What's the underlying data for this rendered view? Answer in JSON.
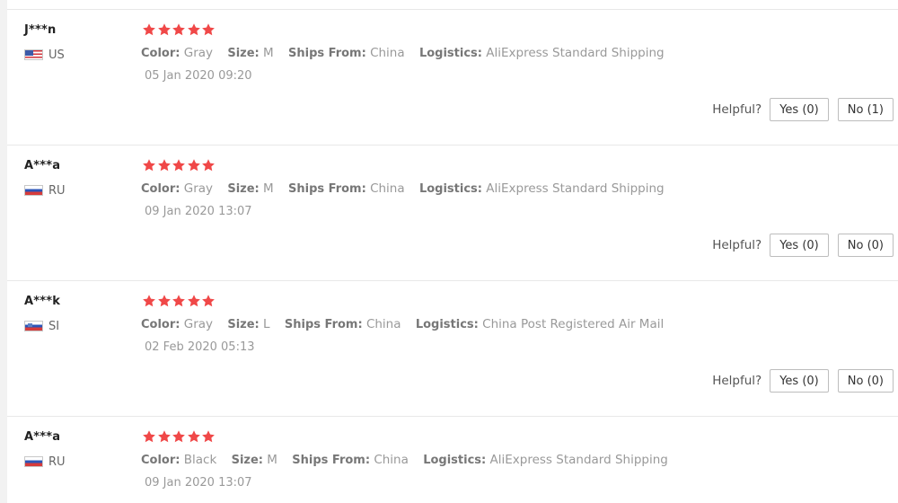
{
  "labels": {
    "color": "Color:",
    "size": "Size:",
    "ships_from": "Ships From:",
    "logistics": "Logistics:",
    "helpful": "Helpful?"
  },
  "star_color": "#f04848",
  "reviews": [
    {
      "user": "J***n",
      "country": "US",
      "flag_icon": "us-flag-icon",
      "rating": 5,
      "color": "Gray",
      "size": "M",
      "ships_from": "China",
      "logistics": "AliExpress Standard Shipping",
      "date": "05 Jan 2020 09:20",
      "yes": "Yes (0)",
      "no": "No (1)"
    },
    {
      "user": "A***a",
      "country": "RU",
      "flag_icon": "ru-flag-icon",
      "rating": 5,
      "color": "Gray",
      "size": "M",
      "ships_from": "China",
      "logistics": "AliExpress Standard Shipping",
      "date": "09 Jan 2020 13:07",
      "yes": "Yes (0)",
      "no": "No (0)"
    },
    {
      "user": "A***k",
      "country": "SI",
      "flag_icon": "si-flag-icon",
      "rating": 5,
      "color": "Gray",
      "size": "L",
      "ships_from": "China",
      "logistics": "China Post Registered Air Mail",
      "date": "02 Feb 2020 05:13",
      "yes": "Yes (0)",
      "no": "No (0)"
    },
    {
      "user": "A***a",
      "country": "RU",
      "flag_icon": "ru-flag-icon",
      "rating": 5,
      "color": "Black",
      "size": "M",
      "ships_from": "China",
      "logistics": "AliExpress Standard Shipping",
      "date": "09 Jan 2020 13:07"
    }
  ]
}
